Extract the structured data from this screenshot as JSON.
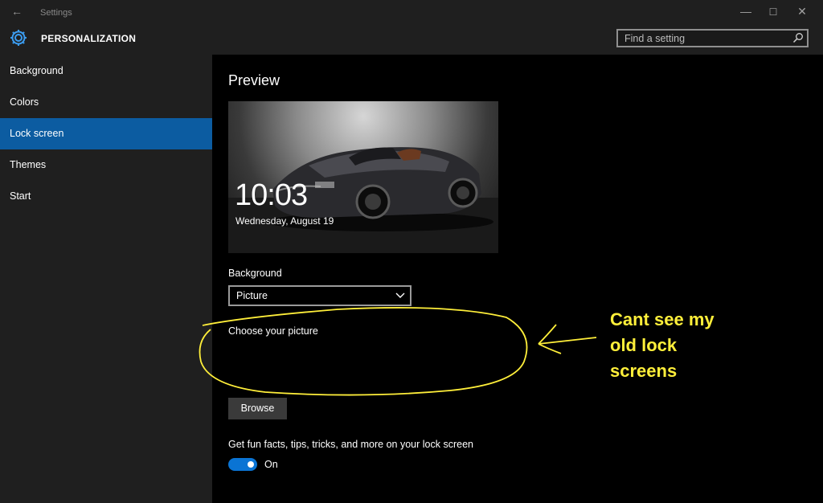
{
  "window": {
    "title": "Settings",
    "back_glyph": "←",
    "minimize_glyph": "—",
    "maximize_glyph": "☐",
    "close_glyph": "✕"
  },
  "header": {
    "app_title": "PERSONALIZATION",
    "search_placeholder": "Find a setting"
  },
  "sidebar": {
    "items": [
      {
        "label": "Background",
        "selected": false
      },
      {
        "label": "Colors",
        "selected": false
      },
      {
        "label": "Lock screen",
        "selected": true
      },
      {
        "label": "Themes",
        "selected": false
      },
      {
        "label": "Start",
        "selected": false
      }
    ]
  },
  "main": {
    "preview_heading": "Preview",
    "preview": {
      "time": "10:03",
      "date": "Wednesday, August 19"
    },
    "background_label": "Background",
    "background_value": "Picture",
    "choose_picture_label": "Choose your picture",
    "browse_label": "Browse",
    "fun_facts_label": "Get fun facts, tips, tricks, and more on your lock screen",
    "toggle_state": "On"
  },
  "annotation": {
    "lines": [
      "Cant see my",
      "old lock",
      "screens"
    ]
  },
  "colors": {
    "accent": "#0c5ca1",
    "toggle": "#0a74d4",
    "annotation": "#ffef3a"
  }
}
